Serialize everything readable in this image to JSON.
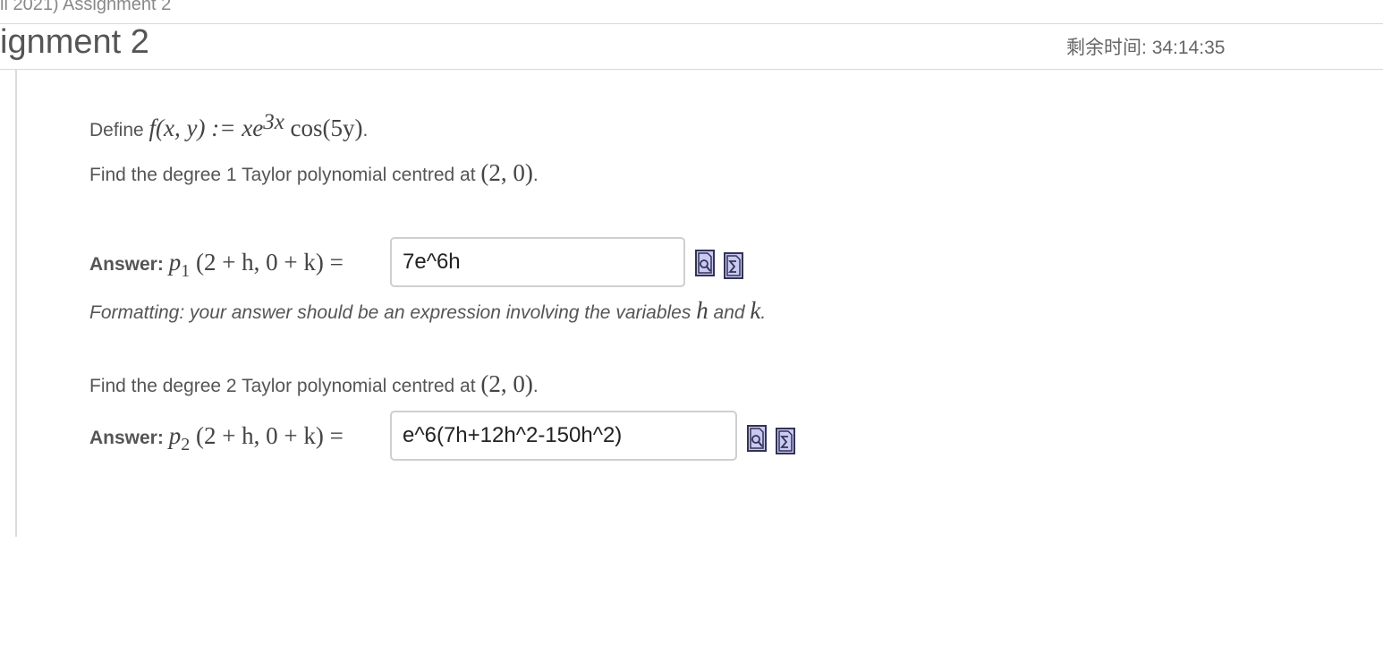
{
  "header": {
    "breadcrumb": "ll 2021) Assignment 2",
    "title": "ignment 2",
    "timer_label": "剩余时间:",
    "timer_value": "34:14:35"
  },
  "question": {
    "define_label": "Define",
    "function_def": {
      "lhs": "f(x, y) := xe",
      "exponent": "3x",
      "rest": " cos(5y)",
      "end": "."
    },
    "part1_prompt": "Find the degree 1 Taylor polynomial centred at",
    "part2_prompt": "Find the degree 2 Taylor polynomial centred at",
    "centre_point": "(2, 0)",
    "period": ".",
    "answer_label": "Answer:",
    "p1": {
      "name": "p",
      "subscript": "1",
      "args": "(2 + h, 0 + k) ="
    },
    "p2": {
      "name": "p",
      "subscript": "2",
      "args": "(2 + h, 0 + k) ="
    },
    "answer1_value": "7e^6h",
    "answer2_value": "e^6(7h+12h^2-150h^2)",
    "formatting_text": "Formatting: your answer should be an expression involving the variables",
    "var_h": "h",
    "var_and": " and ",
    "var_k": "k"
  },
  "icons": {
    "preview": "preview-icon",
    "equation_editor": "sigma-equation-icon"
  },
  "colors": {
    "text": "#555555",
    "icon_fill": "#c9c9f4",
    "icon_border": "#333355",
    "input_border": "#cfcfcf"
  }
}
